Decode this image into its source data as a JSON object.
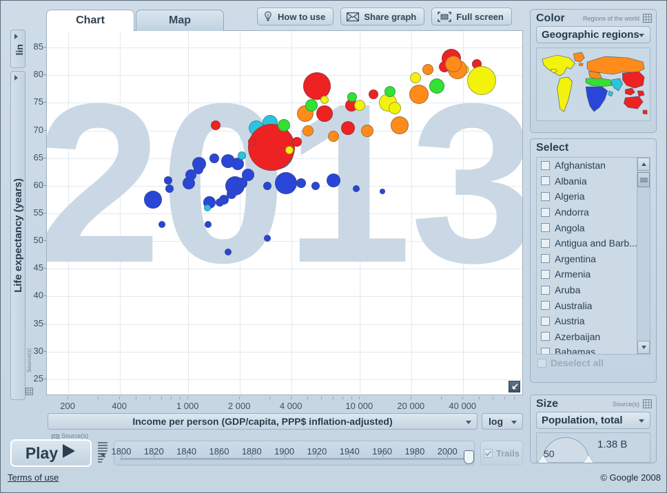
{
  "tabs": [
    {
      "label": "Chart",
      "active": true
    },
    {
      "label": "Map",
      "active": false
    }
  ],
  "toolbar": {
    "how_to_use": "How to use",
    "share_graph": "Share graph",
    "full_screen": "Full screen"
  },
  "yaxis": {
    "scale": "lin",
    "label": "Life expectancy (years)",
    "source": "Source(s)"
  },
  "xaxis": {
    "label": "Income per person (GDP/capita, PPP$ inflation-adjusted)",
    "scale": "log",
    "source": "Source(s)"
  },
  "timeline": {
    "play": "Play",
    "trails": "Trails",
    "years": [
      "1800",
      "1820",
      "1840",
      "1860",
      "1880",
      "1900",
      "1920",
      "1940",
      "1960",
      "1980",
      "2000"
    ],
    "current_year": "2013"
  },
  "color_panel": {
    "title": "Color",
    "hint": "Regions of the world",
    "selected": "Geographic regions"
  },
  "select_panel": {
    "title": "Select",
    "countries": [
      "Afghanistan",
      "Albania",
      "Algeria",
      "Andorra",
      "Angola",
      "Antigua and Barb...",
      "Argentina",
      "Armenia",
      "Aruba",
      "Australia",
      "Austria",
      "Azerbaijan",
      "Bahamas"
    ],
    "deselect_all": "Deselect all"
  },
  "size_panel": {
    "title": "Size",
    "hint": "Source(s)",
    "selected": "Population, total",
    "min_label": "50",
    "max_label": "1.38 B"
  },
  "footer": {
    "terms": "Terms of use",
    "copyright": "© Google 2008"
  },
  "region_colors": {
    "americas": "#f2f20d",
    "europe_central_asia": "#ff8c1a",
    "sub_saharan_africa": "#2a46d8",
    "middle_east_north_africa": "#33e033",
    "east_asia_pacific": "#ee2222",
    "south_asia": "#2bc4e0"
  },
  "chart_data": {
    "type": "scatter",
    "title": "2013",
    "xlabel": "Income per person (GDP/capita, PPP$ inflation-adjusted)",
    "ylabel": "Life expectancy (years)",
    "xscale": "log",
    "yscale": "linear",
    "xlim": [
      150,
      90000
    ],
    "ylim": [
      22,
      88
    ],
    "xticks": [
      200,
      400,
      1000,
      2000,
      4000,
      10000,
      20000,
      40000
    ],
    "xticklabels": [
      "200",
      "400",
      "1 000",
      "2 000",
      "4 000",
      "10 000",
      "20 000",
      "40 000"
    ],
    "yticks": [
      25,
      30,
      35,
      40,
      45,
      50,
      55,
      60,
      65,
      70,
      75,
      80,
      85
    ],
    "grid": true,
    "legend": "none",
    "size_variable": "Population, total",
    "color_variable": "Geographic regions",
    "points": [
      {
        "x": 1870,
        "y": 60.0,
        "r": 14,
        "c": "#2a46d8"
      },
      {
        "x": 620,
        "y": 57.5,
        "r": 13,
        "c": "#2a46d8"
      },
      {
        "x": 1330,
        "y": 57.0,
        "r": 9,
        "c": "#2a46d8"
      },
      {
        "x": 1010,
        "y": 60.5,
        "r": 9,
        "c": "#2a46d8"
      },
      {
        "x": 1040,
        "y": 62.0,
        "r": 8,
        "c": "#2a46d8"
      },
      {
        "x": 1160,
        "y": 64.0,
        "r": 10,
        "c": "#2a46d8"
      },
      {
        "x": 1150,
        "y": 63.0,
        "r": 7,
        "c": "#2a46d8"
      },
      {
        "x": 760,
        "y": 61.0,
        "r": 6,
        "c": "#2a46d8"
      },
      {
        "x": 780,
        "y": 59.5,
        "r": 6,
        "c": "#2a46d8"
      },
      {
        "x": 1420,
        "y": 65.0,
        "r": 7,
        "c": "#2a46d8"
      },
      {
        "x": 1700,
        "y": 64.5,
        "r": 10,
        "c": "#2a46d8"
      },
      {
        "x": 1940,
        "y": 64.0,
        "r": 9,
        "c": "#2a46d8"
      },
      {
        "x": 2240,
        "y": 62.0,
        "r": 9,
        "c": "#2a46d8"
      },
      {
        "x": 2060,
        "y": 60.5,
        "r": 8,
        "c": "#2a46d8"
      },
      {
        "x": 1780,
        "y": 58.5,
        "r": 7,
        "c": "#2a46d8"
      },
      {
        "x": 1620,
        "y": 57.5,
        "r": 7,
        "c": "#2a46d8"
      },
      {
        "x": 1530,
        "y": 57.0,
        "r": 6,
        "c": "#2a46d8"
      },
      {
        "x": 2900,
        "y": 60.0,
        "r": 6,
        "c": "#2a46d8"
      },
      {
        "x": 3700,
        "y": 60.5,
        "r": 16,
        "c": "#2a46d8"
      },
      {
        "x": 4550,
        "y": 60.5,
        "r": 7,
        "c": "#2a46d8"
      },
      {
        "x": 5500,
        "y": 60.0,
        "r": 6,
        "c": "#2a46d8"
      },
      {
        "x": 7000,
        "y": 61.0,
        "r": 10,
        "c": "#2a46d8"
      },
      {
        "x": 9500,
        "y": 59.5,
        "r": 5,
        "c": "#2a46d8"
      },
      {
        "x": 13500,
        "y": 59.0,
        "r": 4,
        "c": "#2a46d8"
      },
      {
        "x": 700,
        "y": 53.0,
        "r": 5,
        "c": "#2a46d8"
      },
      {
        "x": 1300,
        "y": 53.0,
        "r": 5,
        "c": "#2a46d8"
      },
      {
        "x": 2900,
        "y": 50.5,
        "r": 5,
        "c": "#2a46d8"
      },
      {
        "x": 1700,
        "y": 48.0,
        "r": 5,
        "c": "#2a46d8"
      },
      {
        "x": 3300,
        "y": 66.0,
        "r": 24,
        "c": "#2bc4e0"
      },
      {
        "x": 2500,
        "y": 70.5,
        "r": 11,
        "c": "#2bc4e0"
      },
      {
        "x": 2060,
        "y": 65.5,
        "r": 6,
        "c": "#2bc4e0"
      },
      {
        "x": 1290,
        "y": 56.0,
        "r": 5,
        "c": "#2bc4e0"
      },
      {
        "x": 3000,
        "y": 71.5,
        "r": 11,
        "c": "#2bc4e0"
      },
      {
        "x": 5600,
        "y": 78.0,
        "r": 20,
        "c": "#ee2222"
      },
      {
        "x": 3050,
        "y": 67.0,
        "r": 34,
        "c": "#ee2222"
      },
      {
        "x": 1450,
        "y": 71.0,
        "r": 7,
        "c": "#ee2222"
      },
      {
        "x": 6200,
        "y": 73.0,
        "r": 12,
        "c": "#ee2222"
      },
      {
        "x": 34000,
        "y": 83.0,
        "r": 14,
        "c": "#ee2222"
      },
      {
        "x": 31000,
        "y": 81.5,
        "r": 8,
        "c": "#ee2222"
      },
      {
        "x": 8900,
        "y": 74.5,
        "r": 9,
        "c": "#ee2222"
      },
      {
        "x": 12000,
        "y": 76.5,
        "r": 7,
        "c": "#ee2222"
      },
      {
        "x": 48000,
        "y": 82.0,
        "r": 7,
        "c": "#ee2222"
      },
      {
        "x": 8500,
        "y": 70.5,
        "r": 10,
        "c": "#ee2222"
      },
      {
        "x": 4300,
        "y": 68.0,
        "r": 7,
        "c": "#ee2222"
      },
      {
        "x": 2350,
        "y": 68.0,
        "r": 6,
        "c": "#ee2222"
      },
      {
        "x": 41000,
        "y": 81.0,
        "r": 6,
        "c": "#f2f20d"
      },
      {
        "x": 51000,
        "y": 79.0,
        "r": 21,
        "c": "#f2f20d"
      },
      {
        "x": 14500,
        "y": 75.0,
        "r": 13,
        "c": "#f2f20d"
      },
      {
        "x": 16000,
        "y": 74.0,
        "r": 9,
        "c": "#f2f20d"
      },
      {
        "x": 10000,
        "y": 74.5,
        "r": 8,
        "c": "#f2f20d"
      },
      {
        "x": 6200,
        "y": 75.5,
        "r": 6,
        "c": "#f2f20d"
      },
      {
        "x": 21000,
        "y": 79.5,
        "r": 8,
        "c": "#f2f20d"
      },
      {
        "x": 3900,
        "y": 66.5,
        "r": 6,
        "c": "#f2f20d"
      },
      {
        "x": 25000,
        "y": 81.0,
        "r": 8,
        "c": "#ff8c1a"
      },
      {
        "x": 37000,
        "y": 81.0,
        "r": 14,
        "c": "#ff8c1a"
      },
      {
        "x": 35000,
        "y": 82.0,
        "r": 12,
        "c": "#ff8c1a"
      },
      {
        "x": 22000,
        "y": 76.5,
        "r": 14,
        "c": "#ff8c1a"
      },
      {
        "x": 17000,
        "y": 71.0,
        "r": 13,
        "c": "#ff8c1a"
      },
      {
        "x": 11000,
        "y": 70.0,
        "r": 9,
        "c": "#ff8c1a"
      },
      {
        "x": 7000,
        "y": 69.0,
        "r": 8,
        "c": "#ff8c1a"
      },
      {
        "x": 5000,
        "y": 70.0,
        "r": 8,
        "c": "#ff8c1a"
      },
      {
        "x": 4800,
        "y": 73.0,
        "r": 12,
        "c": "#ff8c1a"
      },
      {
        "x": 9000,
        "y": 76.0,
        "r": 7,
        "c": "#33e033"
      },
      {
        "x": 5200,
        "y": 74.5,
        "r": 9,
        "c": "#33e033"
      },
      {
        "x": 3600,
        "y": 71.0,
        "r": 9,
        "c": "#33e033"
      },
      {
        "x": 15000,
        "y": 77.0,
        "r": 8,
        "c": "#33e033"
      },
      {
        "x": 28000,
        "y": 78.0,
        "r": 11,
        "c": "#33e033"
      }
    ]
  }
}
